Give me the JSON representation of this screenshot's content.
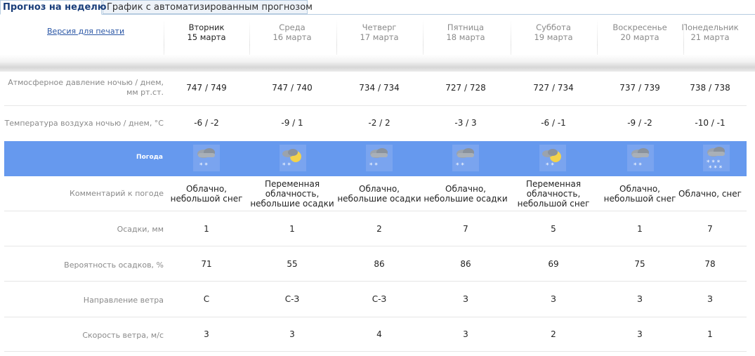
{
  "tabs": [
    {
      "label": "Прогноз на неделю",
      "active": true
    },
    {
      "label": "График с автоматизированным прогнозом",
      "active": false
    }
  ],
  "print_link": "Версия для печати",
  "days": [
    {
      "name": "Вторник",
      "date": "15 марта",
      "today": true,
      "icon": "cloudy-light-snow-icon"
    },
    {
      "name": "Среда",
      "date": "16 марта",
      "today": false,
      "icon": "partly-cloudy-light-snow-icon"
    },
    {
      "name": "Четверг",
      "date": "17 марта",
      "today": false,
      "icon": "cloudy-light-snow-icon"
    },
    {
      "name": "Пятница",
      "date": "18 марта",
      "today": false,
      "icon": "cloudy-light-snow-icon"
    },
    {
      "name": "Суббота",
      "date": "19 марта",
      "today": false,
      "icon": "partly-cloudy-light-snow-icon"
    },
    {
      "name": "Воскресенье",
      "date": "20 марта",
      "today": false,
      "icon": "cloudy-light-snow-icon"
    },
    {
      "name": "Понедельник",
      "date": "21 марта",
      "today": false,
      "icon": "cloudy-snow-icon"
    }
  ],
  "rows": {
    "pressure": {
      "label": "Атмосферное давление ночью  /  днем, мм рт.ст.",
      "values": [
        "747 / 749",
        "747 / 740",
        "734 / 734",
        "727 / 728",
        "727 / 734",
        "737 / 739",
        "738 / 738"
      ]
    },
    "temperature": {
      "label": "Температура воздуха ночью  /  днем, °С",
      "values": [
        "-6 / -2",
        "-9 / 1",
        "-2 / 2",
        "-3 / 3",
        "-6 / -1",
        "-9 / -2",
        "-10 / -1"
      ]
    },
    "weather": {
      "label": "Погода"
    },
    "comment": {
      "label": "Комментарий к погоде",
      "values": [
        "Облачно, небольшой снег",
        "Переменная облачность, небольшие осадки",
        "Облачно, небольшие осадки",
        "Облачно, небольшие осадки",
        "Переменная облачность, небольшой снег",
        "Облачно, небольшой снег",
        "Облачно, снег"
      ]
    },
    "precip": {
      "label": "Осадки, мм",
      "values": [
        "1",
        "1",
        "2",
        "7",
        "5",
        "1",
        "7"
      ]
    },
    "prob": {
      "label": "Вероятность осадков, %",
      "values": [
        "71",
        "55",
        "86",
        "86",
        "69",
        "75",
        "78"
      ]
    },
    "wind_dir": {
      "label": "Направление ветра",
      "values": [
        "С",
        "С-З",
        "С-З",
        "З",
        "З",
        "З",
        "З"
      ]
    },
    "wind_speed": {
      "label": "Скорость ветра, м/с",
      "values": [
        "3",
        "3",
        "4",
        "3",
        "2",
        "3",
        "1"
      ]
    }
  },
  "colors": {
    "weather_band": "#6699ee",
    "link": "#2a56a5",
    "tab_active_text": "#1a3e7a"
  }
}
